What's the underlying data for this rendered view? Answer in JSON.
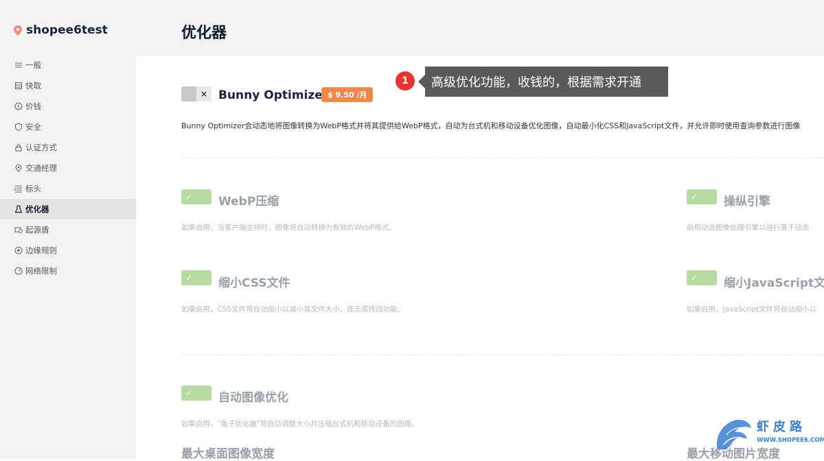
{
  "sidebar": {
    "brand": "shopee6test",
    "items": [
      {
        "label": "一般",
        "icon": "menu-icon"
      },
      {
        "label": "快取",
        "icon": "cache-icon"
      },
      {
        "label": "价钱",
        "icon": "dollar-icon"
      },
      {
        "label": "安全",
        "icon": "shield-icon"
      },
      {
        "label": "认证方式",
        "icon": "lock-icon"
      },
      {
        "label": "交通经理",
        "icon": "location-icon"
      },
      {
        "label": "标头",
        "icon": "header-icon"
      },
      {
        "label": "优化器",
        "icon": "optimizer-icon",
        "active": true
      },
      {
        "label": "起源盾",
        "icon": "origin-shield-icon"
      },
      {
        "label": "边缘规则",
        "icon": "edge-rules-icon"
      },
      {
        "label": "网络限制",
        "icon": "network-limit-icon"
      }
    ]
  },
  "header": {
    "title": "优化器"
  },
  "bunny": {
    "title": "Bunny Optimizer",
    "price": "$ 9.50 /月",
    "toggle_off_symbol": "×",
    "description": "Bunny Optimizer会动态地将图像转换为WebP格式并将其提供给WebP格式，自动为台式机和移动设备优化图像，自动最小化CSS和JavaScript文件，并允许即时使用查询参数进行图像"
  },
  "annotation": {
    "number": "1",
    "text": "高级优化功能，收钱的，根据需求开通"
  },
  "features": {
    "webp": {
      "title": "WebP压缩",
      "desc": "如果启用，当客户端支持时，图像将自动转换为有效的WebP格式。"
    },
    "engine": {
      "title": "操纵引擎",
      "desc": "启用动态图像处理引擎以进行基于动态"
    },
    "css": {
      "title": "缩小CSS文件",
      "desc": "如果启用，CSS文件将自动缩小以减小其文件大小，而无需修改功能。"
    },
    "js": {
      "title": "缩小JavaScript文件",
      "desc": "如果启用，JavaScript文件将自动缩小以"
    },
    "auto_image": {
      "title": "自动图像优化",
      "desc": "如果启用，\"兔子优化器\"将自动调整大小并压缩台式机和移动设备的图像。"
    }
  },
  "fields": {
    "desktop_width": "最大桌面图像宽度",
    "mobile_width": "最大移动图片宽度"
  },
  "watermark": {
    "text": "虾皮路",
    "url": "WWW.SHOPEE6.COM"
  },
  "check_symbol": "✓"
}
